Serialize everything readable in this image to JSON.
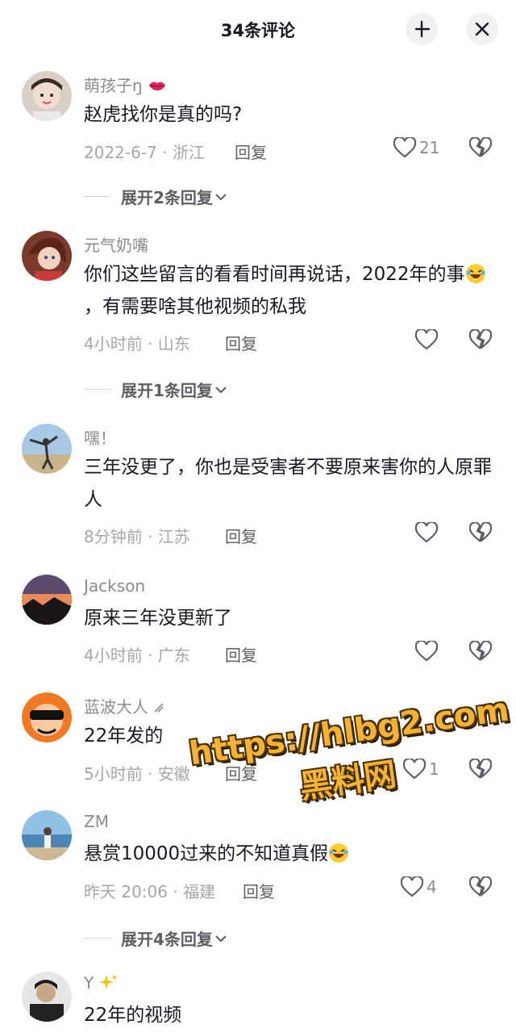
{
  "header": {
    "title": "34条评论",
    "collapse_icon": "collapse-icon",
    "close_icon": "close-icon"
  },
  "comments": [
    {
      "username": "萌孩子ŋ",
      "text": "赵虎找你是真的吗?",
      "meta": "2022-6-7 · 浙江",
      "reply": "回复",
      "likes": "21"
    },
    {
      "username": "元气奶嘴",
      "text": "你们这些留言的看看时间再说话，2022年的事",
      "text_after_emoji": "，有需要啥其他视频的私我",
      "meta": "4小时前 · 山东",
      "reply": "回复",
      "likes": ""
    },
    {
      "username": "嘿！",
      "text": "三年没更了，你也是受害者不要原来害你的人原罪人",
      "meta": "8分钟前 · 江苏",
      "reply": "回复",
      "likes": ""
    },
    {
      "username": "Jackson",
      "text": "原来三年没更新了",
      "meta": "4小时前 · 广东",
      "reply": "回复",
      "likes": ""
    },
    {
      "username": "蓝波大人",
      "text": "22年发的",
      "meta": "5小时前 · 安徽",
      "reply": "回复",
      "likes": "1"
    },
    {
      "username": "ZM",
      "text": "悬赏10000过来的不知道真假",
      "meta": "昨天 20:06 · 福建",
      "reply": "回复",
      "likes": "4"
    },
    {
      "username": "Y",
      "text": "22年的视频"
    }
  ],
  "expanders": [
    "展开2条回复",
    "展开1条回复",
    "展开4条回复"
  ],
  "watermark": {
    "line1": "https://hlbg2.com",
    "line2": "黑料网"
  },
  "colors": {
    "accent_text": "#161823",
    "muted": "#a5a6ab",
    "watermark": "#f2b233"
  }
}
